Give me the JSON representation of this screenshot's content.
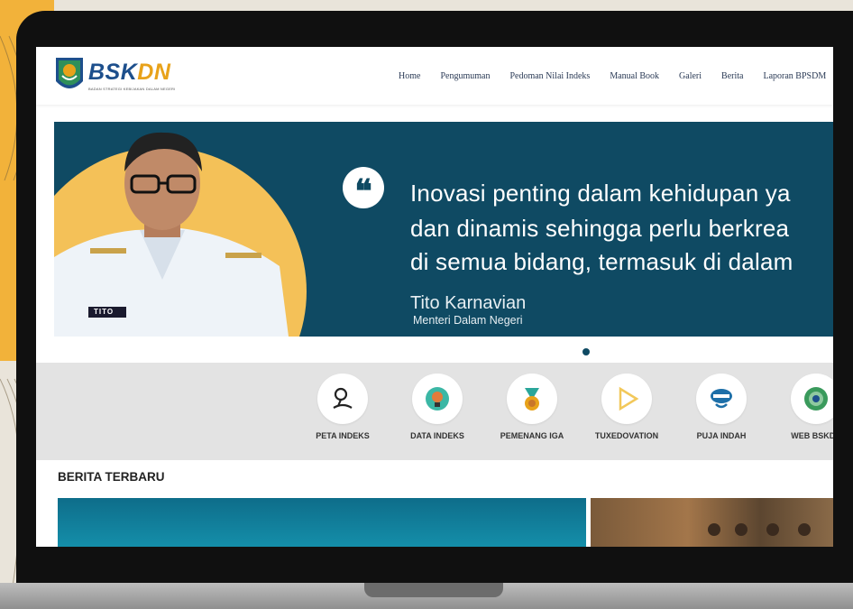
{
  "brand": {
    "logo_main": "BSK",
    "logo_accent": "DN",
    "logo_subtitle": "BADAN STRATEGI KEBIJAKAN DALAM NEGERI"
  },
  "nav": {
    "items": [
      "Home",
      "Pengumuman",
      "Pedoman Nilai Indeks",
      "Manual Book",
      "Galeri",
      "Berita",
      "Laporan BPSDM"
    ]
  },
  "hero": {
    "quote_mark": "❝",
    "quote_lines": [
      "Inovasi penting dalam kehidupan ya",
      "dan dinamis sehingga perlu berkrea",
      "di semua bidang, termasuk di dalam"
    ],
    "author_name": "Tito Karnavian",
    "author_role": "Menteri Dalam Negeri",
    "badge_text": "TITO"
  },
  "features": [
    {
      "label": "PETA INDEKS",
      "icon": "map-pin-icon"
    },
    {
      "label": "DATA INDEKS",
      "icon": "lightbulb-icon"
    },
    {
      "label": "PEMENANG IGA",
      "icon": "medal-icon"
    },
    {
      "label": "TUXEDOVATION",
      "icon": "play-icon"
    },
    {
      "label": "PUJA INDAH",
      "icon": "puja-indah-logo-icon"
    },
    {
      "label": "WEB BSKDN",
      "icon": "emblem-icon"
    }
  ],
  "news": {
    "section_title": "BERITA TERBARU"
  },
  "colors": {
    "brand_blue": "#1d4f8c",
    "brand_orange": "#e8a21a",
    "hero_bg": "#0f4a63",
    "hero_circle": "#f4c158"
  }
}
